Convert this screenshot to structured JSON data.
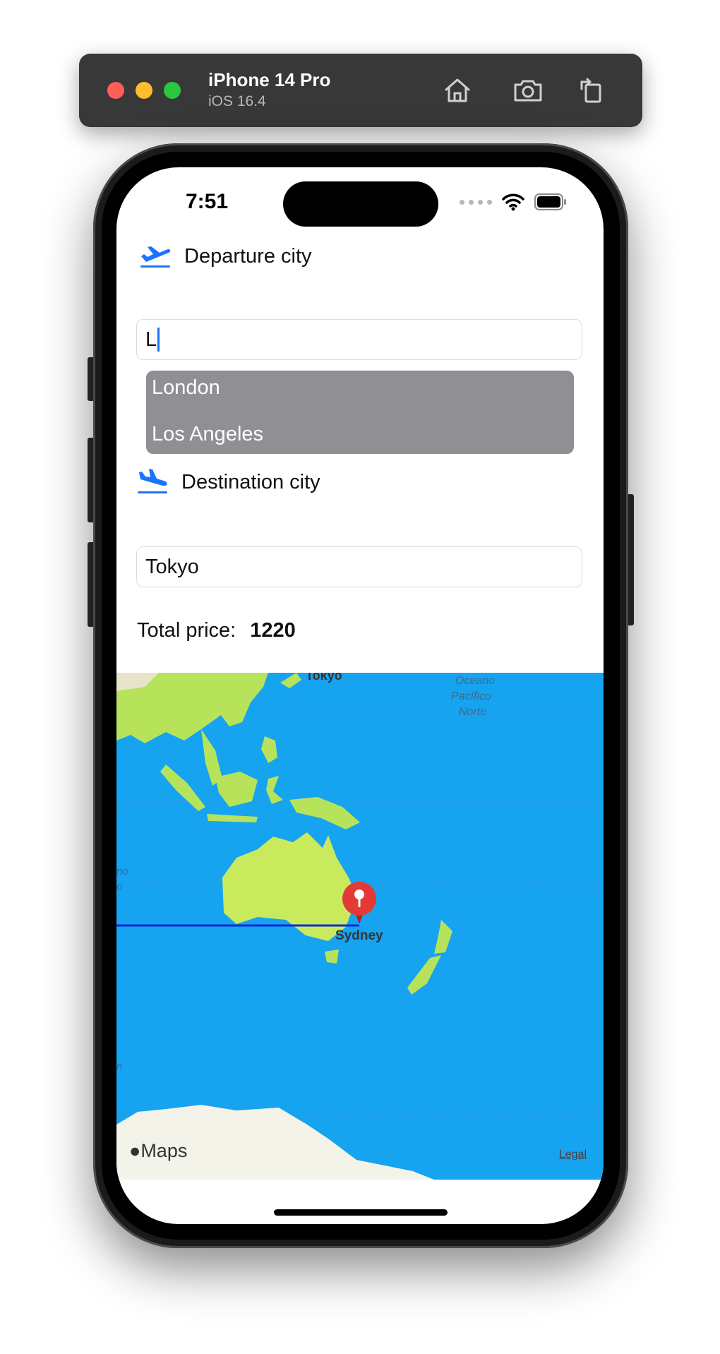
{
  "simulator": {
    "device_name": "iPhone 14 Pro",
    "os_version": "iOS 16.4",
    "icons": [
      "home-icon",
      "screenshot-camera-icon",
      "rotate-icon"
    ]
  },
  "status_bar": {
    "time": "7:51",
    "icons": [
      "signal-dots-icon",
      "wifi-icon",
      "battery-icon"
    ]
  },
  "departure": {
    "label": "Departure city",
    "icon": "plane-departure-icon",
    "input_value": "L",
    "suggestions": [
      "London",
      "Los Angeles"
    ]
  },
  "destination": {
    "label": "Destination city",
    "icon": "plane-arrival-icon",
    "input_value": "Tokyo"
  },
  "price": {
    "label": "Total price:",
    "value": "1220"
  },
  "map": {
    "labels": {
      "tokyo": "Tokyo",
      "ocean_line1": "Oceano",
      "ocean_line2": "Pacífico",
      "ocean_line3": "Norte",
      "sydney": "Sydney",
      "left_cut_1": "no",
      "left_cut_2": "o",
      "left_cut_3": "n"
    },
    "pin_icon": "map-pin-icon",
    "route_color": "#0a2bd6",
    "attribution": "Maps",
    "legal": "Legal"
  },
  "colors": {
    "accent": "#1a73ff",
    "suggestion_bg": "#8f8f94",
    "ocean": "#16a3f0",
    "land": "#b7e35a",
    "pin": "#e43a36"
  }
}
